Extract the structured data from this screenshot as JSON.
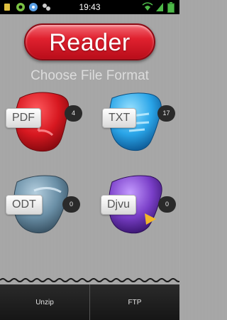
{
  "statusbar": {
    "time": "19:43",
    "left_icons": [
      "usb-icon",
      "android-icon",
      "messenger-icon",
      "notification-icon"
    ],
    "right_icons": [
      "wifi-icon",
      "signal-icon",
      "battery-icon"
    ]
  },
  "app": {
    "title": "Reader",
    "subtitle": "Choose File Format"
  },
  "formats": [
    {
      "label": "PDF",
      "count": "4",
      "color": "#d71820"
    },
    {
      "label": "TXT",
      "count": "17",
      "color": "#2aa5e8"
    },
    {
      "label": "ODT",
      "count": "0",
      "color": "#6a8fa6"
    },
    {
      "label": "Djvu",
      "count": "0",
      "color": "#7a3fc8"
    }
  ],
  "bottombar": {
    "unzip_label": "Unzip",
    "ftp_label": "FTP"
  }
}
